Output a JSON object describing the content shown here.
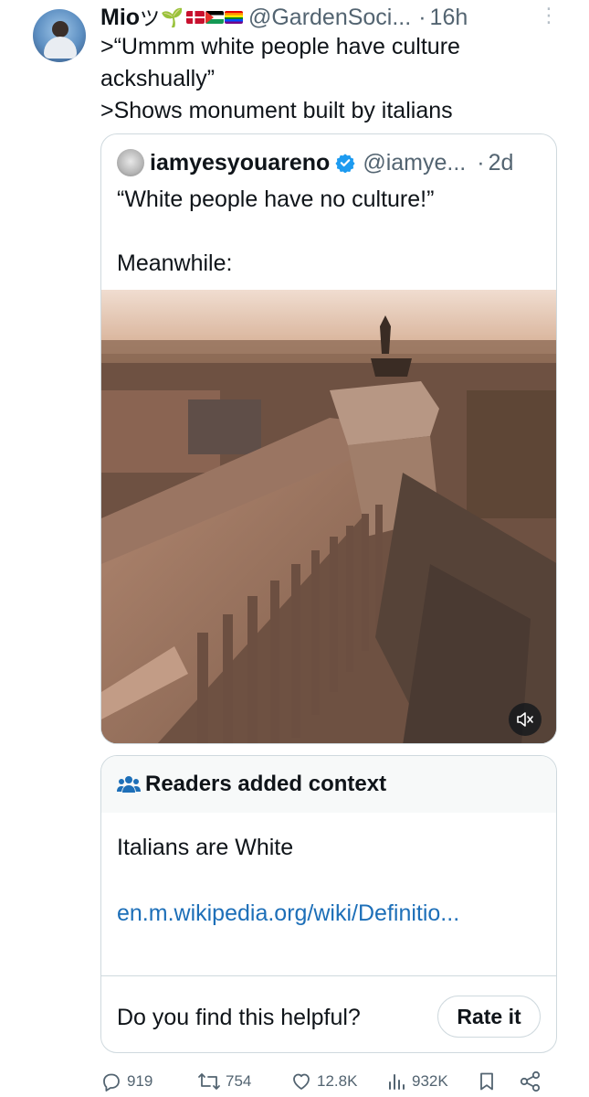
{
  "author": {
    "name": "Mio",
    "name_suffix": "ツ",
    "handle": "@GardenSoci...",
    "time": "16h"
  },
  "tweet": {
    "lines": [
      ">“Ummm white people have culture",
      "ackshually”",
      ">Shows monument built by italians"
    ]
  },
  "quoted": {
    "name": "iamyesyouareno",
    "handle": "@iamye...",
    "time": "2d",
    "line1": "“White people have no culture!”",
    "line2": "Meanwhile:"
  },
  "context": {
    "title": "Readers added context",
    "body": "Italians are White",
    "link": "en.m.wikipedia.org/wiki/Definitio...",
    "question": "Do you find this helpful?",
    "rate_label": "Rate it"
  },
  "actions": {
    "replies": "919",
    "reposts": "754",
    "likes": "12.8K",
    "views": "932K"
  },
  "icons": {
    "more": "more-icon",
    "verified": "verified-badge-icon",
    "mute": "mute-icon",
    "community": "community-notes-icon",
    "reply": "reply-icon",
    "repost": "repost-icon",
    "like": "like-icon",
    "views": "views-icon",
    "bookmark": "bookmark-icon",
    "share": "share-icon"
  },
  "colors": {
    "text": "#0f1419",
    "secondary": "#536471",
    "border": "#cfd9de",
    "link": "#1d6fb8",
    "verified": "#1d9bf0",
    "context_header_bg": "#f7f9f9"
  }
}
